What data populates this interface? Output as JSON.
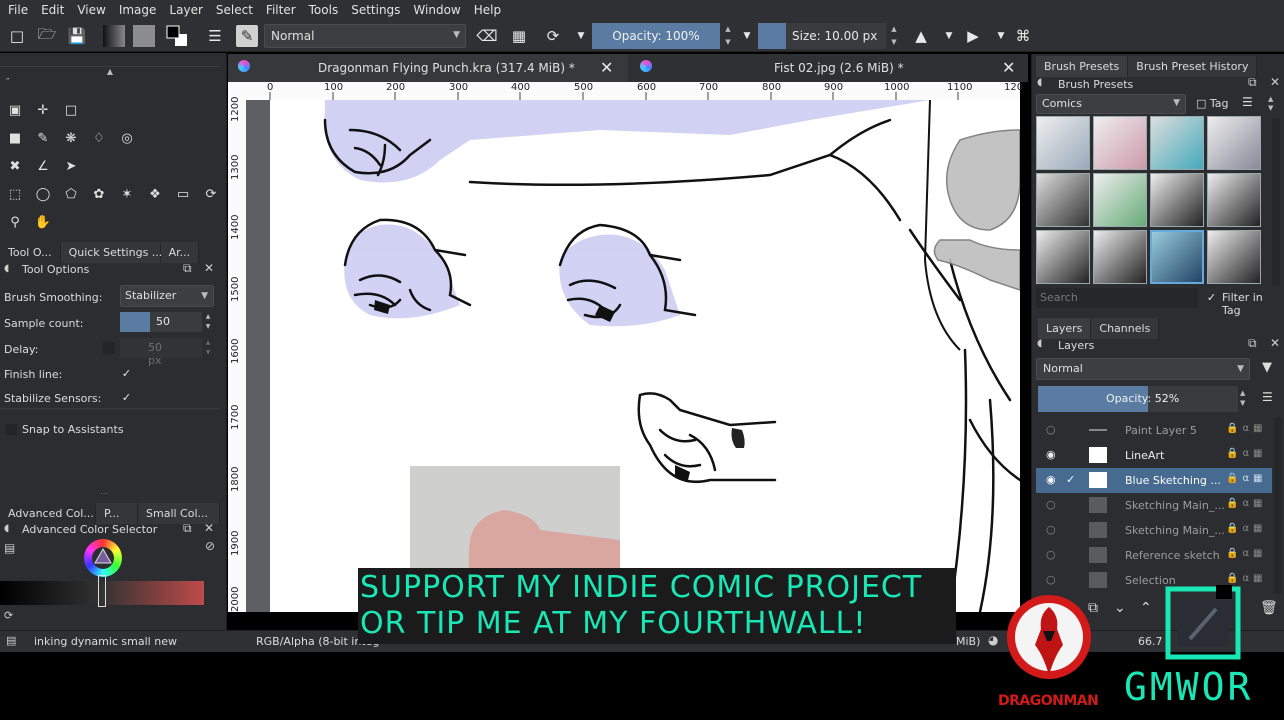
{
  "menu": [
    "File",
    "Edit",
    "View",
    "Image",
    "Layer",
    "Select",
    "Filter",
    "Tools",
    "Settings",
    "Window",
    "Help"
  ],
  "toolbar": {
    "blend_mode": "Normal",
    "opacity": "Opacity: 100%",
    "size": "Size: 10.00 px"
  },
  "documents": [
    {
      "title": "Dragonman Flying Punch.kra (317.4 MiB) *"
    },
    {
      "title": "Fist 02.jpg (2.6 MiB) *"
    }
  ],
  "ruler_h": [
    "0",
    "100",
    "200",
    "300",
    "400",
    "500",
    "600",
    "700",
    "800",
    "900",
    "1000",
    "1100",
    "120"
  ],
  "ruler_v": [
    "1200",
    "1300",
    "1400",
    "1500",
    "1600",
    "1700",
    "1800",
    "1900",
    "2000"
  ],
  "left_tabs": [
    "Tool O...",
    "Quick Settings ...",
    "Ar..."
  ],
  "tool_options": {
    "title": "Tool Options",
    "smoothing_label": "Brush Smoothing:",
    "smoothing_value": "Stabilizer",
    "sample_label": "Sample count:",
    "sample_value": "50",
    "delay_label": "Delay:",
    "delay_value": "50 px",
    "finish_label": "Finish line:",
    "stabilize_label": "Stabilize Sensors:",
    "snap_label": "Snap to Assistants"
  },
  "color_tabs": [
    "Advanced Col...",
    "P...",
    "Small Col..."
  ],
  "color_selector_title": "Advanced Color Selector",
  "right_tabs": [
    "Brush Presets",
    "Brush Preset History"
  ],
  "brush_presets": {
    "title": "Brush Presets",
    "tag": "Comics",
    "tag_button": "Tag",
    "search_placeholder": "Search",
    "filter_label": "Filter in Tag"
  },
  "layer_tabs": [
    "Layers",
    "Channels"
  ],
  "layers": {
    "title": "Layers",
    "blend": "Normal",
    "opacity": "Opacity:  52%",
    "items": [
      {
        "name": "Paint Layer 5",
        "visible": false,
        "selected": false
      },
      {
        "name": "LineArt",
        "visible": true,
        "selected": false
      },
      {
        "name": "Blue Sketching ...",
        "visible": true,
        "selected": true
      },
      {
        "name": "Sketching Main_...",
        "visible": false,
        "selected": false
      },
      {
        "name": "Sketching Main_...",
        "visible": false,
        "selected": false
      },
      {
        "name": "Reference sketch",
        "visible": false,
        "selected": false
      },
      {
        "name": "Selection",
        "visible": false,
        "selected": false
      }
    ]
  },
  "status": {
    "brush_name": "inking dynamic small new",
    "color_space": "RGB/Alpha (8-bit integ",
    "mem": "MiB)",
    "zoom": "66.7"
  },
  "banner": {
    "line1": "SUPPORT MY INDIE COMIC PROJECT",
    "line2": "OR TIP ME AT MY FOURTHWALL!"
  },
  "logos": {
    "dragonman": "DRAGONMAN",
    "gmwor": "GMWOR"
  },
  "colors": {
    "accent": "#5a7ca3",
    "banner_text": "#19e8b6",
    "sketch_blue": "#c9caf2",
    "logo_red": "#d21a1a"
  }
}
